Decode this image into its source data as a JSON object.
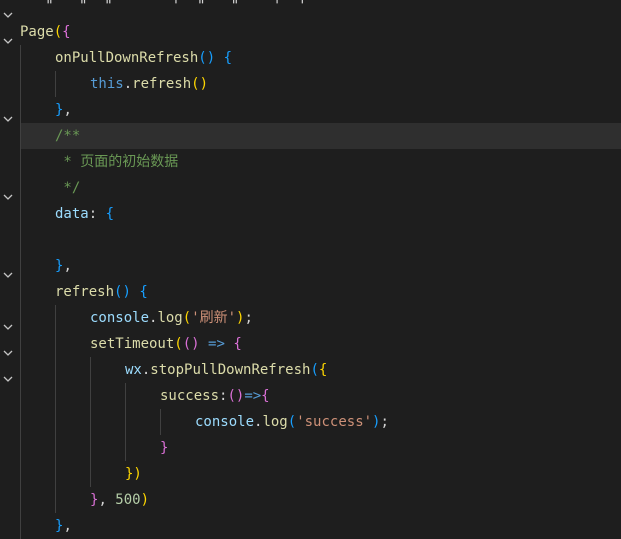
{
  "editor": {
    "lines": [
      {
        "indent": 0,
        "tokens": [
          {
            "t": "   \"   \"  \"       '  \"   \"    '  '",
            "c": "plain"
          }
        ]
      },
      {
        "indent": 0,
        "tokens": [
          {
            "t": "Page",
            "c": "kw-fn"
          },
          {
            "t": "(",
            "c": "b1"
          },
          {
            "t": "{",
            "c": "b2"
          }
        ]
      },
      {
        "indent": 1,
        "tokens": [
          {
            "t": "onPullDownRefresh",
            "c": "kw-fn"
          },
          {
            "t": "() ",
            "c": "b3"
          },
          {
            "t": "{",
            "c": "b3"
          }
        ]
      },
      {
        "indent": 2,
        "tokens": [
          {
            "t": "this",
            "c": "kw-this"
          },
          {
            "t": ".",
            "c": "plain"
          },
          {
            "t": "refresh",
            "c": "kw-fn"
          },
          {
            "t": "()",
            "c": "b1"
          }
        ]
      },
      {
        "indent": 1,
        "tokens": [
          {
            "t": "}",
            "c": "b3"
          },
          {
            "t": ",",
            "c": "plain"
          }
        ]
      },
      {
        "indent": 1,
        "tokens": [
          {
            "t": "/**",
            "c": "cmt"
          }
        ]
      },
      {
        "indent": 1,
        "tokens": [
          {
            "t": " * 页面的初始数据",
            "c": "cmt"
          }
        ]
      },
      {
        "indent": 1,
        "tokens": [
          {
            "t": " */",
            "c": "cmt"
          }
        ]
      },
      {
        "indent": 1,
        "tokens": [
          {
            "t": "data",
            "c": "kw-prop"
          },
          {
            "t": ": ",
            "c": "plain"
          },
          {
            "t": "{",
            "c": "b3"
          }
        ]
      },
      {
        "indent": 1,
        "tokens": []
      },
      {
        "indent": 1,
        "tokens": [
          {
            "t": "}",
            "c": "b3"
          },
          {
            "t": ",",
            "c": "plain"
          }
        ]
      },
      {
        "indent": 1,
        "tokens": [
          {
            "t": "refresh",
            "c": "kw-fn"
          },
          {
            "t": "() ",
            "c": "b3"
          },
          {
            "t": "{",
            "c": "b3"
          }
        ]
      },
      {
        "indent": 2,
        "tokens": [
          {
            "t": "console",
            "c": "kw-prop"
          },
          {
            "t": ".",
            "c": "plain"
          },
          {
            "t": "log",
            "c": "kw-fn"
          },
          {
            "t": "(",
            "c": "b1"
          },
          {
            "t": "'刷新'",
            "c": "str"
          },
          {
            "t": ")",
            "c": "b1"
          },
          {
            "t": ";",
            "c": "plain"
          }
        ]
      },
      {
        "indent": 2,
        "tokens": [
          {
            "t": "setTimeout",
            "c": "kw-fn"
          },
          {
            "t": "(",
            "c": "b1"
          },
          {
            "t": "() ",
            "c": "b2"
          },
          {
            "t": "=>",
            "c": "arrow"
          },
          {
            "t": " {",
            "c": "b2"
          }
        ]
      },
      {
        "indent": 3,
        "tokens": [
          {
            "t": "wx",
            "c": "kw-prop"
          },
          {
            "t": ".",
            "c": "plain"
          },
          {
            "t": "stopPullDownRefresh",
            "c": "kw-fn"
          },
          {
            "t": "(",
            "c": "b3"
          },
          {
            "t": "{",
            "c": "b1"
          }
        ]
      },
      {
        "indent": 4,
        "tokens": [
          {
            "t": "success",
            "c": "kw-fn"
          },
          {
            "t": ":",
            "c": "plain"
          },
          {
            "t": "()",
            "c": "b2"
          },
          {
            "t": "=>",
            "c": "arrow"
          },
          {
            "t": "{",
            "c": "b2"
          }
        ]
      },
      {
        "indent": 5,
        "tokens": [
          {
            "t": "console",
            "c": "kw-prop"
          },
          {
            "t": ".",
            "c": "plain"
          },
          {
            "t": "log",
            "c": "kw-fn"
          },
          {
            "t": "(",
            "c": "b3"
          },
          {
            "t": "'success'",
            "c": "str"
          },
          {
            "t": ")",
            "c": "b3"
          },
          {
            "t": ";",
            "c": "plain"
          }
        ]
      },
      {
        "indent": 4,
        "tokens": [
          {
            "t": "}",
            "c": "b2"
          }
        ]
      },
      {
        "indent": 3,
        "tokens": [
          {
            "t": "})",
            "c": "b1"
          }
        ]
      },
      {
        "indent": 2,
        "tokens": [
          {
            "t": "}",
            "c": "b2"
          },
          {
            "t": ", ",
            "c": "plain"
          },
          {
            "t": "500",
            "c": "num"
          },
          {
            "t": ")",
            "c": "b1"
          }
        ]
      },
      {
        "indent": 1,
        "tokens": [
          {
            "t": "}",
            "c": "b3"
          },
          {
            "t": ",",
            "c": "plain"
          }
        ]
      }
    ]
  }
}
